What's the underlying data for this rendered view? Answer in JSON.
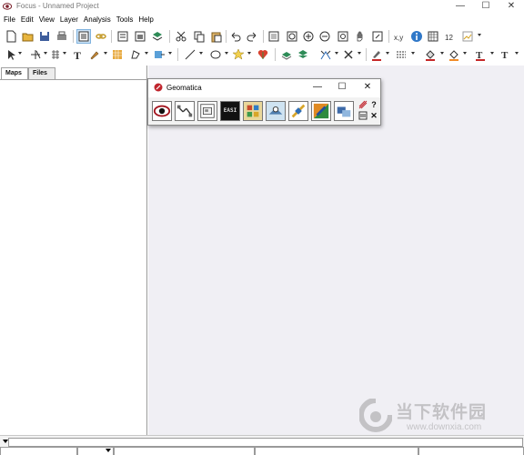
{
  "window": {
    "title": "Focus - Unnamed Project",
    "minimize": "—",
    "maximize": "☐",
    "close": "✕"
  },
  "menu": [
    "File",
    "Edit",
    "View",
    "Layer",
    "Analysis",
    "Tools",
    "Help"
  ],
  "panel": {
    "tabs": [
      "Maps",
      "Files"
    ],
    "active_tab": "Maps"
  },
  "geomatica": {
    "title": "Geomatica",
    "minimize": "—",
    "maximize": "☐",
    "close": "✕",
    "help": "?",
    "close_small": "✕",
    "tools": [
      "focus-tool",
      "modeler-tool",
      "ortho-tool",
      "ease-tool",
      "chip-tool",
      "fly-tool",
      "satellite-tool",
      "mosaic-tool",
      "license-tool",
      "config-tool"
    ],
    "ease_label": "EASI"
  },
  "colors": {
    "accent": "#cde3f6",
    "workspace": "#f0eff4",
    "watermark": "#8d8d8d"
  },
  "watermark": {
    "cn": "当下软件园",
    "url": "www.downxia.com"
  }
}
